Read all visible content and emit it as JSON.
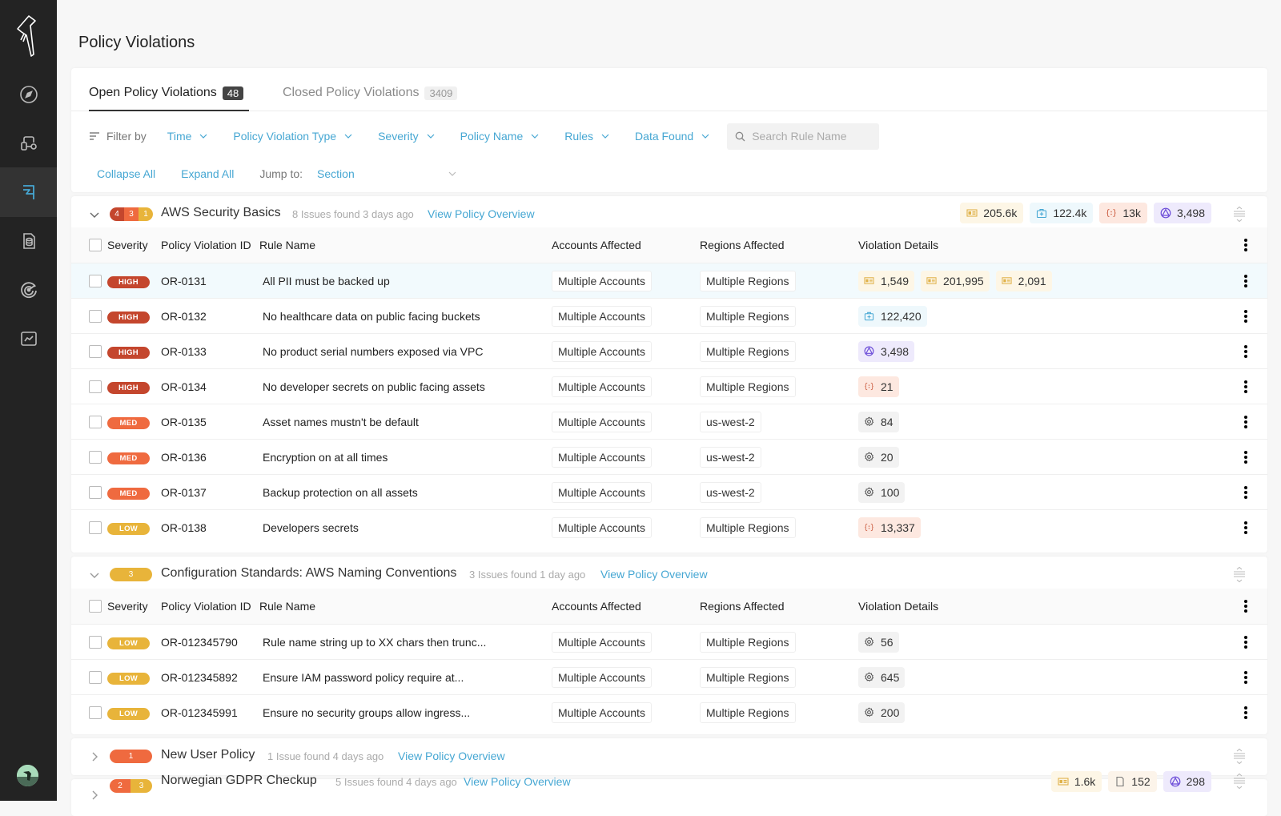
{
  "sidebar": {
    "items": [
      {
        "name": "compass",
        "active": false
      },
      {
        "name": "integrations",
        "active": false
      },
      {
        "name": "policy-flag",
        "active": true
      },
      {
        "name": "data-document",
        "active": false
      },
      {
        "name": "target",
        "active": false
      },
      {
        "name": "analytics",
        "active": false
      }
    ]
  },
  "page": {
    "title": "Policy Violations"
  },
  "tabs": [
    {
      "label": "Open Policy Violations",
      "count": "48"
    },
    {
      "label": "Closed Policy Violations",
      "count": "3409"
    }
  ],
  "filters": {
    "label": "Filter by",
    "items": [
      "Time",
      "Policy Violation Type",
      "Severity",
      "Policy Name",
      "Rules",
      "Data Found"
    ],
    "search_placeholder": "Search Rule Name"
  },
  "actions": {
    "collapse_all": "Collapse All",
    "expand_all": "Expand All",
    "jump_to_label": "Jump to:",
    "jump_to_value": "Section"
  },
  "columns": {
    "severity": "Severity",
    "id": "Policy Violation ID",
    "rule": "Rule Name",
    "accounts": "Accounts Affected",
    "regions": "Regions Affected",
    "details": "Violation Details"
  },
  "colors": {
    "high": "#c4462d",
    "med": "#ef6a3f",
    "low": "#e8b43a",
    "accent": "#46a7d3"
  },
  "sections": [
    {
      "title": "AWS Security Basics",
      "meta": "8 Issues found 3 days ago",
      "link": "View Policy Overview",
      "severity_counts": {
        "high": "4",
        "med": "3",
        "low": "1"
      },
      "stats": [
        {
          "icon": "id-card",
          "value": "205.6k"
        },
        {
          "icon": "medical-kit",
          "value": "122.4k"
        },
        {
          "icon": "code-braces",
          "value": "13k"
        },
        {
          "icon": "product-triangle",
          "value": "3,498"
        }
      ],
      "rows": [
        {
          "severity": "HIGH",
          "id": "OR-0131",
          "rule": "All PII must be backed up",
          "accounts": "Multiple Accounts",
          "regions": "Multiple Regions",
          "details": [
            {
              "icon": "id-card",
              "value": "1,549"
            },
            {
              "icon": "id-card",
              "value": "201,995"
            },
            {
              "icon": "id-card",
              "value": "2,091"
            }
          ]
        },
        {
          "severity": "HIGH",
          "id": "OR-0132",
          "rule": "No healthcare data on public facing buckets",
          "accounts": "Multiple Accounts",
          "regions": "Multiple Regions",
          "details": [
            {
              "icon": "medical-kit",
              "value": "122,420"
            }
          ]
        },
        {
          "severity": "HIGH",
          "id": "OR-0133",
          "rule": "No product serial numbers exposed via VPC",
          "accounts": "Multiple Accounts",
          "regions": "Multiple Regions",
          "details": [
            {
              "icon": "product-triangle",
              "value": "3,498"
            }
          ]
        },
        {
          "severity": "HIGH",
          "id": "OR-0134",
          "rule": "No developer secrets on public facing assets",
          "accounts": "Multiple Accounts",
          "regions": "Multiple Regions",
          "details": [
            {
              "icon": "code-braces",
              "value": "21"
            }
          ]
        },
        {
          "severity": "MED",
          "id": "OR-0135",
          "rule": "Asset names mustn't be default",
          "accounts": "Multiple Accounts",
          "regions": "us-west-2",
          "details": [
            {
              "icon": "gear",
              "value": "84"
            }
          ]
        },
        {
          "severity": "MED",
          "id": "OR-0136",
          "rule": "Encryption on at all times",
          "accounts": "Multiple Accounts",
          "regions": "us-west-2",
          "details": [
            {
              "icon": "gear",
              "value": "20"
            }
          ]
        },
        {
          "severity": "MED",
          "id": "OR-0137",
          "rule": "Backup protection on all assets",
          "accounts": "Multiple Accounts",
          "regions": "us-west-2",
          "details": [
            {
              "icon": "gear",
              "value": "100"
            }
          ]
        },
        {
          "severity": "LOW",
          "id": "OR-0138",
          "rule": "Developers secrets",
          "accounts": "Multiple Accounts",
          "regions": "Multiple Regions",
          "details": [
            {
              "icon": "code-braces",
              "value": "13,337"
            }
          ]
        }
      ]
    },
    {
      "title": "Configuration Standards: AWS Naming Conventions",
      "meta": "3 Issues found 1 day ago",
      "link": "View Policy Overview",
      "severity_counts": {
        "low": "3"
      },
      "stats": [],
      "rows": [
        {
          "severity": "LOW",
          "id": "OR-012345790",
          "rule": "Rule name string up to XX chars then trunc...",
          "accounts": "Multiple Accounts",
          "regions": "Multiple Regions",
          "details": [
            {
              "icon": "gear",
              "value": "56"
            }
          ]
        },
        {
          "severity": "LOW",
          "id": "OR-012345892",
          "rule": "Ensure IAM password policy require at...",
          "accounts": "Multiple Accounts",
          "regions": "Multiple Regions",
          "details": [
            {
              "icon": "gear",
              "value": "645"
            }
          ]
        },
        {
          "severity": "LOW",
          "id": "OR-012345991",
          "rule": "Ensure no security groups allow ingress...",
          "accounts": "Multiple Accounts",
          "regions": "Multiple Regions",
          "details": [
            {
              "icon": "gear",
              "value": "200"
            }
          ]
        }
      ]
    },
    {
      "title": "New User Policy",
      "meta": "1 Issue found 4 days ago",
      "link": "View Policy Overview",
      "severity_counts": {
        "med": "1"
      },
      "stats": []
    },
    {
      "title": "Norwegian GDPR Checkup",
      "meta": "5 Issues found 4 days ago",
      "link": "View Policy Overview",
      "severity_counts": {
        "med": "2",
        "low": "3"
      },
      "stats": [
        {
          "icon": "id-card",
          "value": "1.6k"
        },
        {
          "icon": "document",
          "value": "152"
        },
        {
          "icon": "product-triangle",
          "value": "298"
        }
      ]
    }
  ]
}
